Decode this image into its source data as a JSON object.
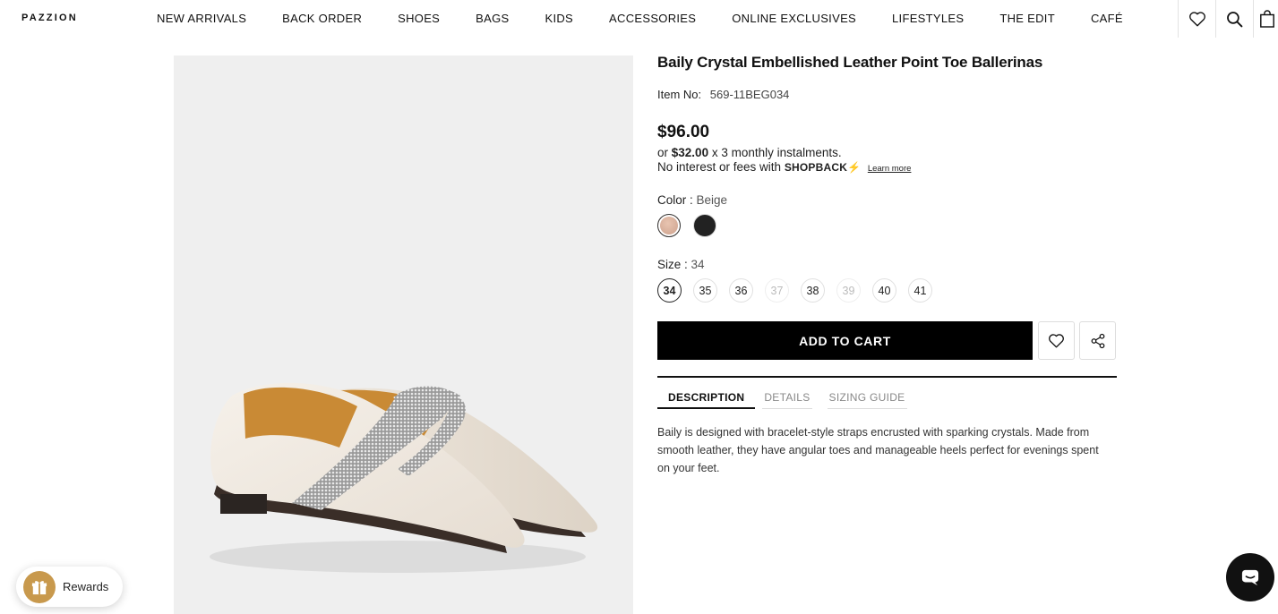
{
  "header": {
    "logo": "PAZZION",
    "nav": [
      {
        "label": "NEW ARRIVALS"
      },
      {
        "label": "BACK ORDER"
      },
      {
        "label": "SHOES"
      },
      {
        "label": "BAGS"
      },
      {
        "label": "KIDS"
      },
      {
        "label": "ACCESSORIES"
      },
      {
        "label": "ONLINE EXCLUSIVES"
      },
      {
        "label": "LIFESTYLES"
      },
      {
        "label": "THE EDIT"
      },
      {
        "label": "CAFÉ"
      }
    ],
    "icons": [
      "heart-icon",
      "search-icon",
      "bag-icon"
    ]
  },
  "product": {
    "title": "Baily Crystal Embellished Leather Point Toe Ballerinas",
    "item_no_label": "Item No:",
    "item_no": "569-11BEG034",
    "price": "$96.00",
    "instalment_prefix": "or",
    "instalment_amount": "$32.00",
    "instalment_suffix": "x 3 monthly instalments.",
    "no_interest": "No interest or fees with",
    "shopback": "SHOPBACK",
    "learn_more": "Learn more",
    "color_label": "Color :",
    "color_value": "Beige",
    "colors": [
      {
        "name": "Beige",
        "hex": "#d8b09c"
      },
      {
        "name": "Black",
        "hex": "#222222"
      }
    ],
    "size_label": "Size :",
    "size_value": "34",
    "sizes": [
      {
        "label": "34",
        "state": "selected"
      },
      {
        "label": "35",
        "state": "available"
      },
      {
        "label": "36",
        "state": "available"
      },
      {
        "label": "37",
        "state": "unavailable"
      },
      {
        "label": "38",
        "state": "available"
      },
      {
        "label": "39",
        "state": "unavailable"
      },
      {
        "label": "40",
        "state": "available"
      },
      {
        "label": "41",
        "state": "available"
      }
    ],
    "add_to_cart": "ADD TO CART",
    "tabs": [
      {
        "label": "DESCRIPTION"
      },
      {
        "label": "DETAILS"
      },
      {
        "label": "SIZING GUIDE"
      }
    ],
    "active_tab": "DESCRIPTION",
    "description": "Baily is designed with bracelet-style straps encrusted with sparking crystals. Made from smooth leather, they have angular toes and manageable heels perfect for evenings spent on your feet."
  },
  "widgets": {
    "rewards": "Rewards"
  },
  "colors": {
    "accent": "#000000",
    "rewards_gold": "#c8994d"
  }
}
